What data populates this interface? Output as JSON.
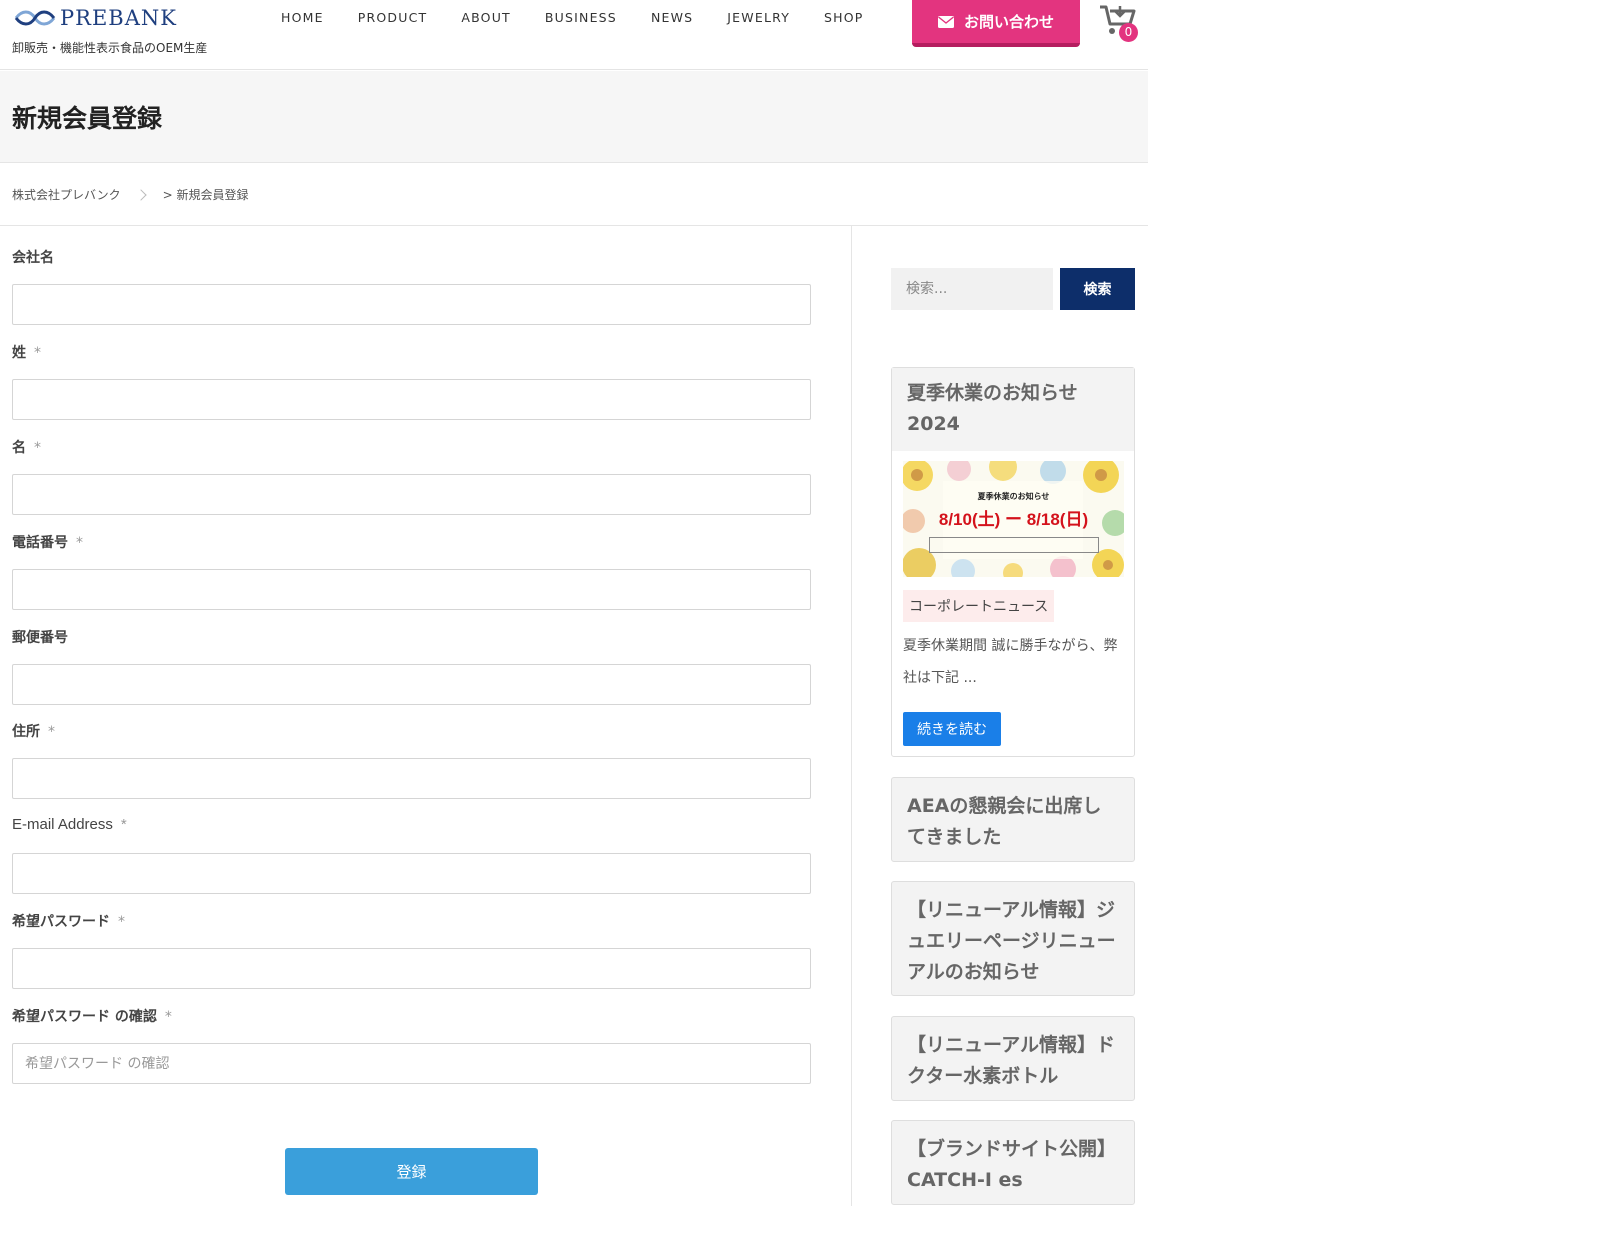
{
  "brand": {
    "name": "PREBANK",
    "tagline": "卸販売・機能性表示食品のOEM生産"
  },
  "nav": [
    "HOME",
    "PRODUCT",
    "ABOUT",
    "BUSINESS",
    "NEWS",
    "JEWELRY",
    "SHOP"
  ],
  "contact": {
    "label": "お問い合わせ"
  },
  "cart": {
    "count": "0"
  },
  "page": {
    "title": "新規会員登録"
  },
  "breadcrumb": {
    "home": "株式会社プレバンク",
    "current": "> 新規会員登録"
  },
  "form": {
    "required_mark": "*",
    "fields": [
      {
        "label": "会社名",
        "required": false,
        "placeholder": ""
      },
      {
        "label": "姓",
        "required": true,
        "placeholder": ""
      },
      {
        "label": "名",
        "required": true,
        "placeholder": ""
      },
      {
        "label": "電話番号",
        "required": true,
        "placeholder": ""
      },
      {
        "label": "郵便番号",
        "required": false,
        "placeholder": ""
      },
      {
        "label": "住所",
        "required": true,
        "placeholder": ""
      },
      {
        "label": "E-mail Address",
        "required": true,
        "placeholder": ""
      },
      {
        "label": "希望パスワード",
        "required": true,
        "placeholder": ""
      },
      {
        "label": "希望パスワード の確認",
        "required": true,
        "placeholder": "希望パスワード の確認"
      }
    ],
    "submit_label": "登録"
  },
  "sidebar": {
    "search": {
      "placeholder": "検索...",
      "button": "検索"
    },
    "featured": {
      "title": "夏季休業のお知らせ 2024",
      "image": {
        "heading": "夏季休業のお知らせ",
        "dates": "8/10(土) ー 8/18(日)"
      },
      "category": "コーポレートニュース",
      "excerpt": "夏季休業期間 誠に勝手ながら、弊社は下記 ...",
      "read_more": "続きを読む"
    },
    "posts": [
      "AEAの懇親会に出席してきました",
      "【リニューアル情報】ジュエリーページリニューアルのお知らせ",
      "【リニューアル情報】ドクター水素ボトル",
      "【ブランドサイト公開】CATCH-I es"
    ]
  },
  "colors": {
    "accent_pink": "#e3347f",
    "navy": "#0d2e6a",
    "submit_blue": "#3a9fdb",
    "readmore_blue": "#1a7fe8"
  }
}
